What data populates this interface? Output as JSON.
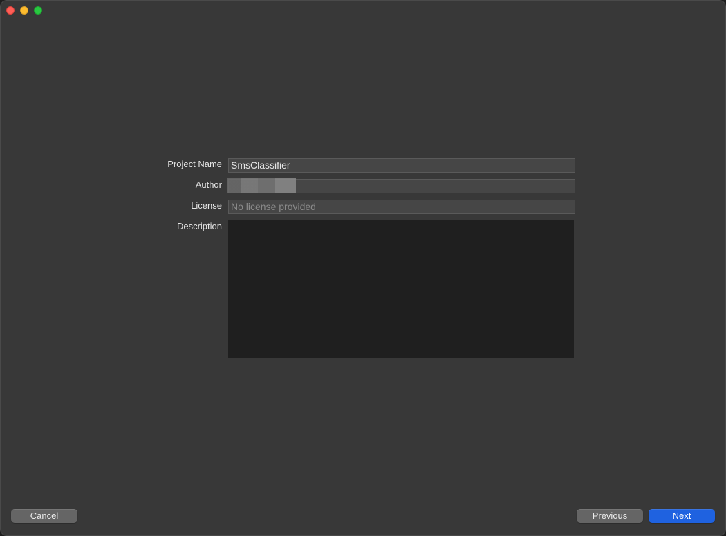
{
  "window": {
    "controls": [
      "close",
      "minimize",
      "zoom"
    ]
  },
  "form": {
    "project_name_label": "Project Name",
    "project_name_value": "SmsClassifier",
    "author_label": "Author",
    "author_value": "",
    "license_label": "License",
    "license_placeholder": "No license provided",
    "description_label": "Description",
    "description_value": ""
  },
  "footer": {
    "cancel_label": "Cancel",
    "previous_label": "Previous",
    "next_label": "Next"
  },
  "colors": {
    "accent": "#1f62e0",
    "window_bg": "#383838",
    "field_bg": "#464646"
  }
}
